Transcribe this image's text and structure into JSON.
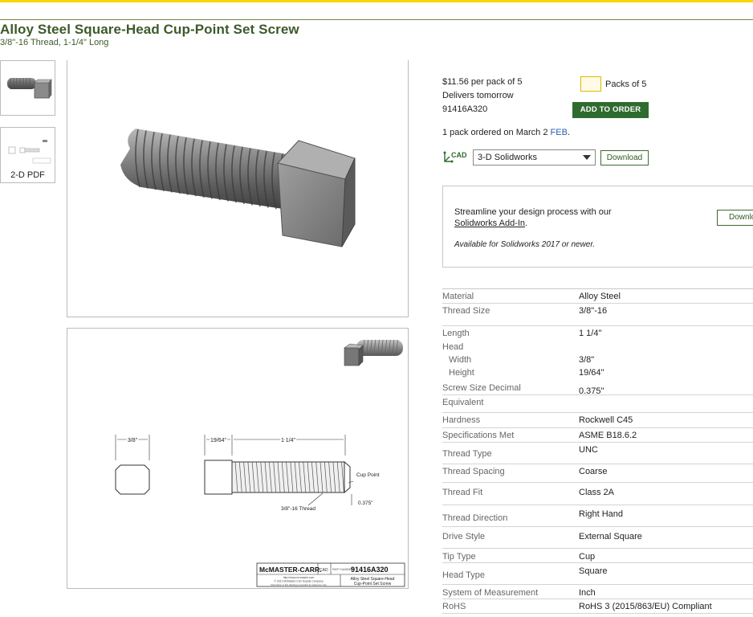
{
  "product": {
    "title": "Alloy Steel Square-Head Cup-Point Set Screw",
    "subtitle": "3/8\"-16 Thread, 1-1/4\" Long"
  },
  "thumbnails": [
    {
      "label": ""
    },
    {
      "label": "2-D PDF"
    }
  ],
  "purchase": {
    "price": "$11.56 per pack of 5",
    "delivery": "Delivers tomorrow",
    "part_number": "91416A320",
    "qty_value": "",
    "qty_label": "Packs of 5",
    "add_button": "ADD TO ORDER",
    "ordered_text": "1 pack ordered on March 2",
    "ordered_link": "FEB",
    "cad_label": "CAD",
    "cad_format": "3-D Solidworks",
    "download_button": "Download"
  },
  "addin": {
    "line1": "Streamline your design process with our",
    "link": "Solidworks Add-In",
    "period": ".",
    "note": "Available for Solidworks 2017 or newer.",
    "button": "Download"
  },
  "drawing": {
    "dim_width": "3/8\"",
    "dim_head": "19/64\"",
    "dim_length": "1 1/4\"",
    "thread_label": "3/8\"-16 Thread",
    "cup_point": "Cup Point",
    "cup_dim": "0.375\"",
    "brand": "McMASTER-CARR.",
    "cad_tag": "CAD",
    "part_tag": "PART NUMBER",
    "part_number": "91416A320",
    "website": "http://www.mcmaster.com",
    "copyright": "© 2021 McMaster-Carr Supply Company",
    "disclaimer": "Information in this drawing is provided for reference only.",
    "caption1": "Alloy Steel Square-Head",
    "caption2": "Cup-Point Set Screw"
  },
  "specs": [
    {
      "label": "Material",
      "value": "Alloy Steel"
    },
    {
      "label": "Thread Size",
      "value": "3/8\"-16"
    },
    {
      "label": "Length",
      "value": "1 1/4\""
    },
    {
      "label": "Head",
      "value": ""
    },
    {
      "label": "Width",
      "value": "3/8\""
    },
    {
      "label": "Height",
      "value": "19/64\""
    },
    {
      "label": "Screw Size Decimal",
      "value": "0.375\""
    },
    {
      "label": "Equivalent",
      "value": ""
    },
    {
      "label": "Hardness",
      "value": "Rockwell C45"
    },
    {
      "label": "Specifications Met",
      "value": "ASME B18.6.2"
    },
    {
      "label": "Thread Type",
      "value": "UNC"
    },
    {
      "label": "Thread Spacing",
      "value": "Coarse"
    },
    {
      "label": "Thread Fit",
      "value": "Class 2A"
    },
    {
      "label": "Thread Direction",
      "value": "Right Hand"
    },
    {
      "label": "Drive Style",
      "value": "External Square"
    },
    {
      "label": "Tip Type",
      "value": "Cup"
    },
    {
      "label": "Head Type",
      "value": "Square"
    },
    {
      "label": "System of Measurement",
      "value": "Inch"
    },
    {
      "label": "RoHS",
      "value": "RoHS 3 (2015/863/EU) Compliant"
    }
  ]
}
